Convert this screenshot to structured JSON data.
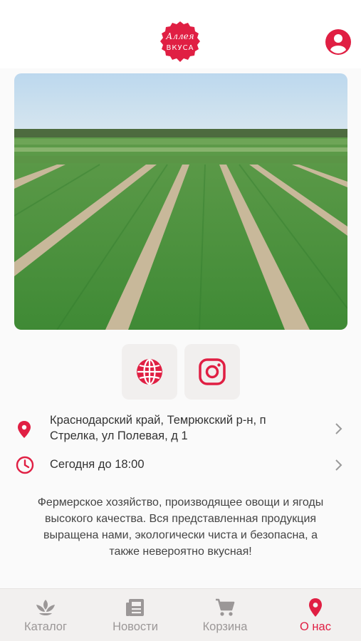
{
  "brand": {
    "logo_line1": "Аллея",
    "logo_line2": "ВКУСА",
    "accent_color": "#e01f43"
  },
  "header": {
    "profile_icon": "user-profile-icon"
  },
  "hero": {
    "image_subject": "field"
  },
  "social": {
    "website_icon": "globe-icon",
    "instagram_icon": "instagram-icon"
  },
  "info": {
    "address_line1": "Краснодарский край, Темрюкский р-н, п",
    "address_line2": "Стрелка, ул Полевая, д 1",
    "hours": "Сегодня до 18:00"
  },
  "description": {
    "line1": "Фермерское хозяйство, производящее овощи и ягоды",
    "line2": "высокого качества. Вся представленная продукция",
    "line3": "выращена нами, экологически чиста и безопасна, а",
    "line4": "также невероятно вкусная!"
  },
  "tabs": [
    {
      "label": "Каталог",
      "icon": "sprout-icon",
      "active": false
    },
    {
      "label": "Новости",
      "icon": "newspaper-icon",
      "active": false
    },
    {
      "label": "Корзина",
      "icon": "cart-icon",
      "active": false
    },
    {
      "label": "О нас",
      "icon": "location-pin-icon",
      "active": true
    }
  ]
}
